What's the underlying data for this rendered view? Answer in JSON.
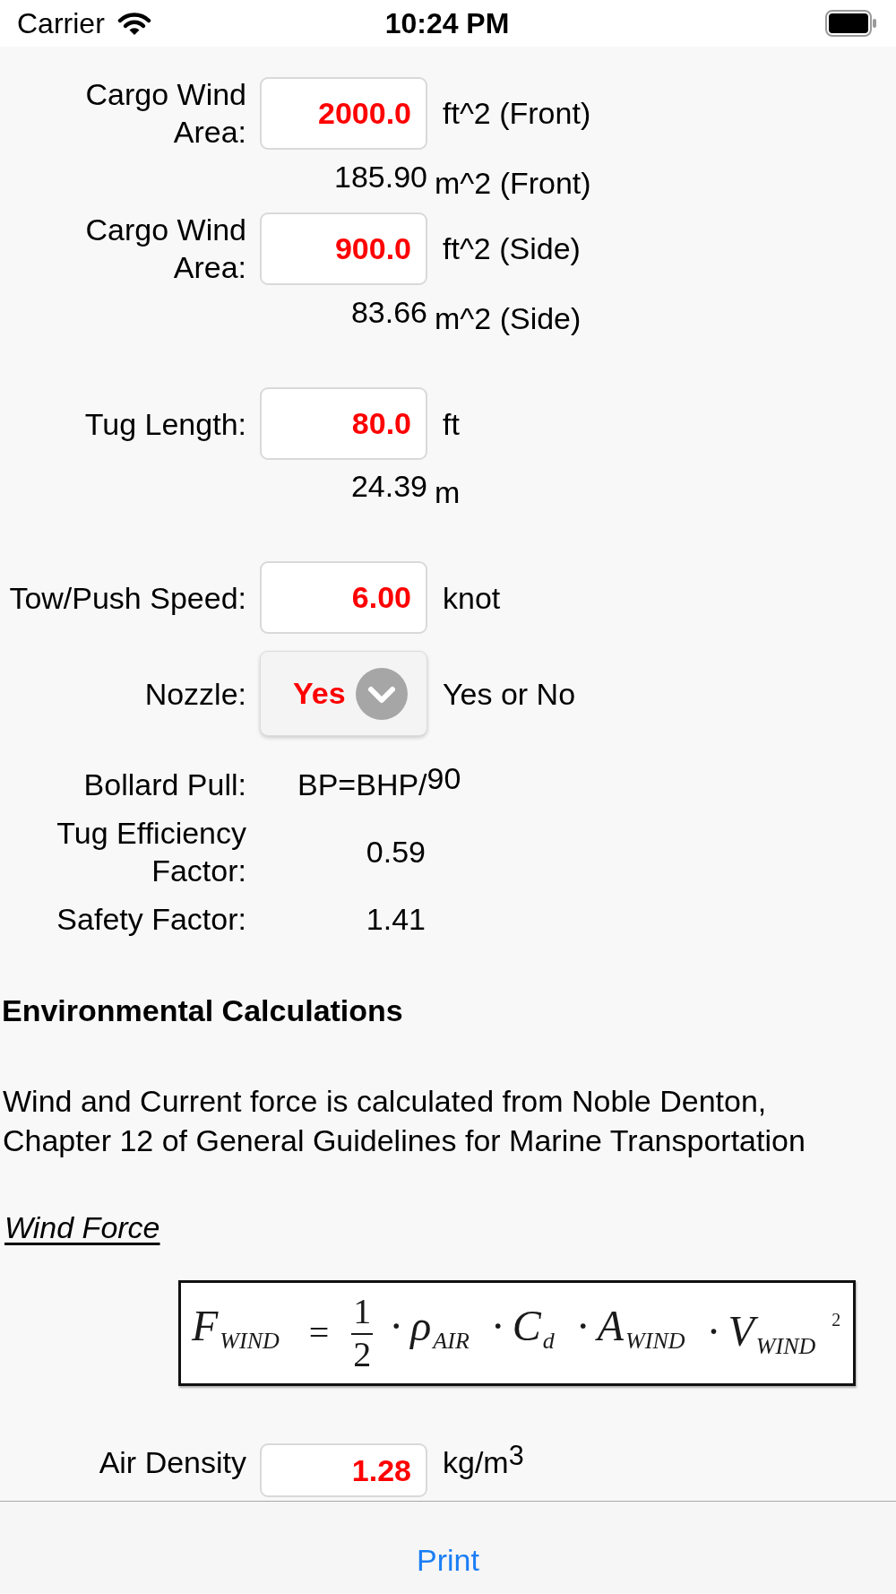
{
  "status_bar": {
    "carrier": "Carrier",
    "time": "10:24 PM"
  },
  "sections": [
    {
      "rows": [
        {
          "kind": "input",
          "label": "Cargo Wind Area:",
          "value": "2000.0",
          "unit": "ft^2 (Front)"
        },
        {
          "kind": "converted",
          "value": "185.90",
          "unit": "m^2 (Front)"
        },
        {
          "kind": "input",
          "label": "Cargo Wind Area:",
          "value": "900.0",
          "unit": "ft^2 (Side)"
        },
        {
          "kind": "converted",
          "value": "83.66",
          "unit": "m^2 (Side)"
        }
      ]
    },
    {
      "rows": [
        {
          "kind": "input",
          "label": "Tug Length:",
          "value": "80.0",
          "unit": "ft"
        },
        {
          "kind": "converted",
          "value": "24.39",
          "unit": "m"
        }
      ]
    },
    {
      "rows": [
        {
          "kind": "input",
          "label": "Tow/Push Speed:",
          "value": "6.00",
          "unit": "knot"
        },
        {
          "kind": "select",
          "label": "Nozzle:",
          "value": "Yes",
          "unit": "Yes or No"
        }
      ]
    },
    {
      "rows": [
        {
          "kind": "formula",
          "label": "Bollard Pull:",
          "value": "BP=BHP/$^{90}$"
        },
        {
          "kind": "constant",
          "label": "Tug Efficiency Factor:",
          "value": "0.59"
        },
        {
          "kind": "constant",
          "label": "Safety Factor:",
          "value": "1.41"
        }
      ]
    }
  ],
  "environmental": {
    "heading": "Environmental Calculations",
    "description": "Wind and Current force is calculated from Noble Denton, Chapter 12 of General Guidelines for Marine Transportation",
    "subheading": "Wind Force",
    "formula": {
      "lhs": {
        "symbol": "F",
        "sub": "WIND"
      },
      "equals": "=",
      "fraction": {
        "numerator": "1",
        "denominator": "2"
      },
      "factors": [
        {
          "op": "·",
          "symbol": "ρ",
          "sub": "AIR"
        },
        {
          "op": "·",
          "symbol": "C",
          "sub": "d"
        },
        {
          "op": "·",
          "symbol": "A",
          "sub": "WIND"
        },
        {
          "op": "·",
          "symbol": "V",
          "sub": "WIND",
          "power": "2"
        }
      ]
    },
    "rows": [
      {
        "kind": "input",
        "label": "Air Density",
        "value": "1.28",
        "unit": "kg/m$^{3}$"
      }
    ]
  },
  "toolbar": {
    "button": "Print"
  }
}
